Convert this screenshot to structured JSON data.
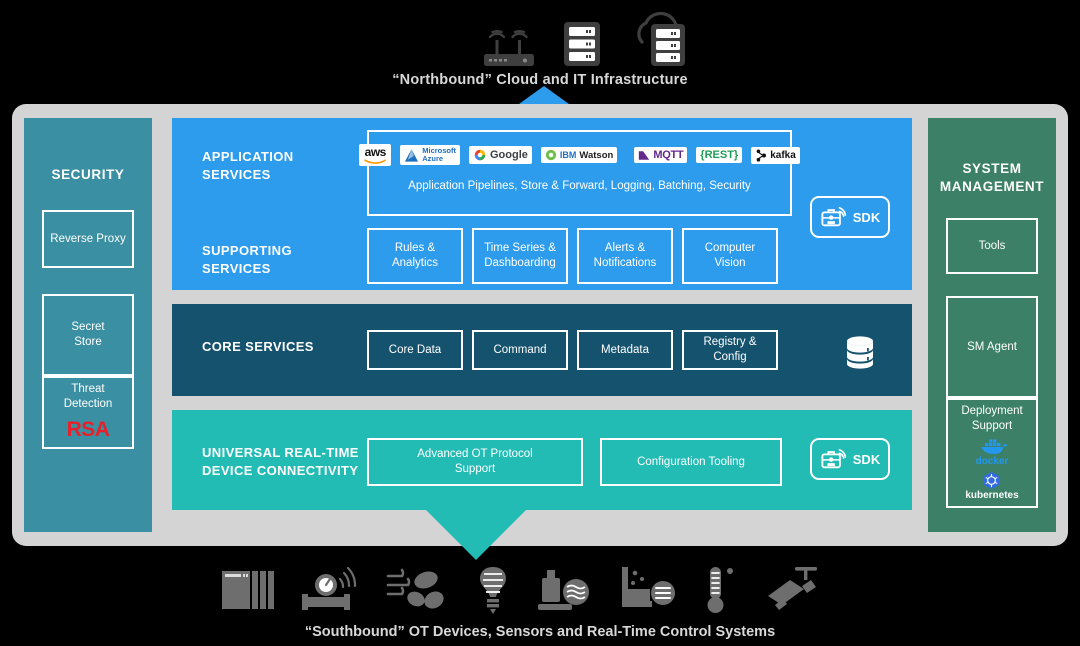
{
  "north": {
    "caption": "“Northbound” Cloud and IT Infrastructure",
    "icons": [
      "router-icon",
      "server-rack-icon",
      "cloud-server-icon"
    ]
  },
  "south": {
    "caption": "“Southbound” OT Devices, Sensors and Real-Time Control Systems",
    "icons": [
      "plc-rack-icon",
      "flow-meter-icon",
      "hvac-fan-icon",
      "light-bulb-icon",
      "lab-analyzer-icon",
      "process-tank-icon",
      "thermometer-icon",
      "security-camera-icon"
    ]
  },
  "security": {
    "title": "SECURITY",
    "boxes": [
      {
        "label": "Reverse Proxy"
      },
      {
        "label": "Secret\nStore"
      },
      {
        "label": "Threat\nDetection",
        "logo": "RSA"
      }
    ]
  },
  "system_management": {
    "title": "SYSTEM\nMANAGEMENT",
    "boxes": [
      {
        "label": "Tools"
      },
      {
        "label": "SM Agent"
      },
      {
        "label": "Deployment\nSupport",
        "logos": [
          "docker",
          "kubernetes"
        ]
      }
    ]
  },
  "application_services": {
    "label": "APPLICATION\nSERVICES",
    "logos": [
      {
        "name": "aws",
        "text": "aws"
      },
      {
        "name": "microsoft-azure",
        "line1": "Microsoft",
        "line2": "Azure"
      },
      {
        "name": "google-cloud",
        "text": "Google"
      },
      {
        "name": "ibm-watson",
        "brand": "IBM",
        "text": "Watson"
      },
      {
        "name": "mqtt",
        "text": "MQTT"
      },
      {
        "name": "rest",
        "text": "{REST}"
      },
      {
        "name": "kafka",
        "text": "kafka"
      }
    ],
    "caption": "Application Pipelines, Store & Forward, Logging, Batching, Security",
    "sdk_label": "SDK"
  },
  "supporting_services": {
    "label": "SUPPORTING\nSERVICES",
    "boxes": [
      "Rules &\nAnalytics",
      "Time Series &\nDashboarding",
      "Alerts &\nNotifications",
      "Computer\nVision"
    ]
  },
  "core_services": {
    "label": "CORE SERVICES",
    "boxes": [
      "Core Data",
      "Command",
      "Metadata",
      "Registry &\nConfig"
    ],
    "database_icon": "database-icon"
  },
  "device_connectivity": {
    "label": "UNIVERSAL REAL-TIME\nDEVICE CONNECTIVITY",
    "boxes": [
      "Advanced OT Protocol\nSupport",
      "Configuration Tooling"
    ],
    "sdk_label": "SDK"
  },
  "colors": {
    "background": "#000000",
    "shell": "#d4d4d4",
    "security_panel": "#3a8fa2",
    "system_panel": "#3c8068",
    "application_band": "#2d9cec",
    "core_band": "#15526e",
    "device_band": "#22bcb5",
    "rsa_red": "#e8202a",
    "docker_blue": "#2396ed",
    "caption_text": "#d8d8d8"
  }
}
